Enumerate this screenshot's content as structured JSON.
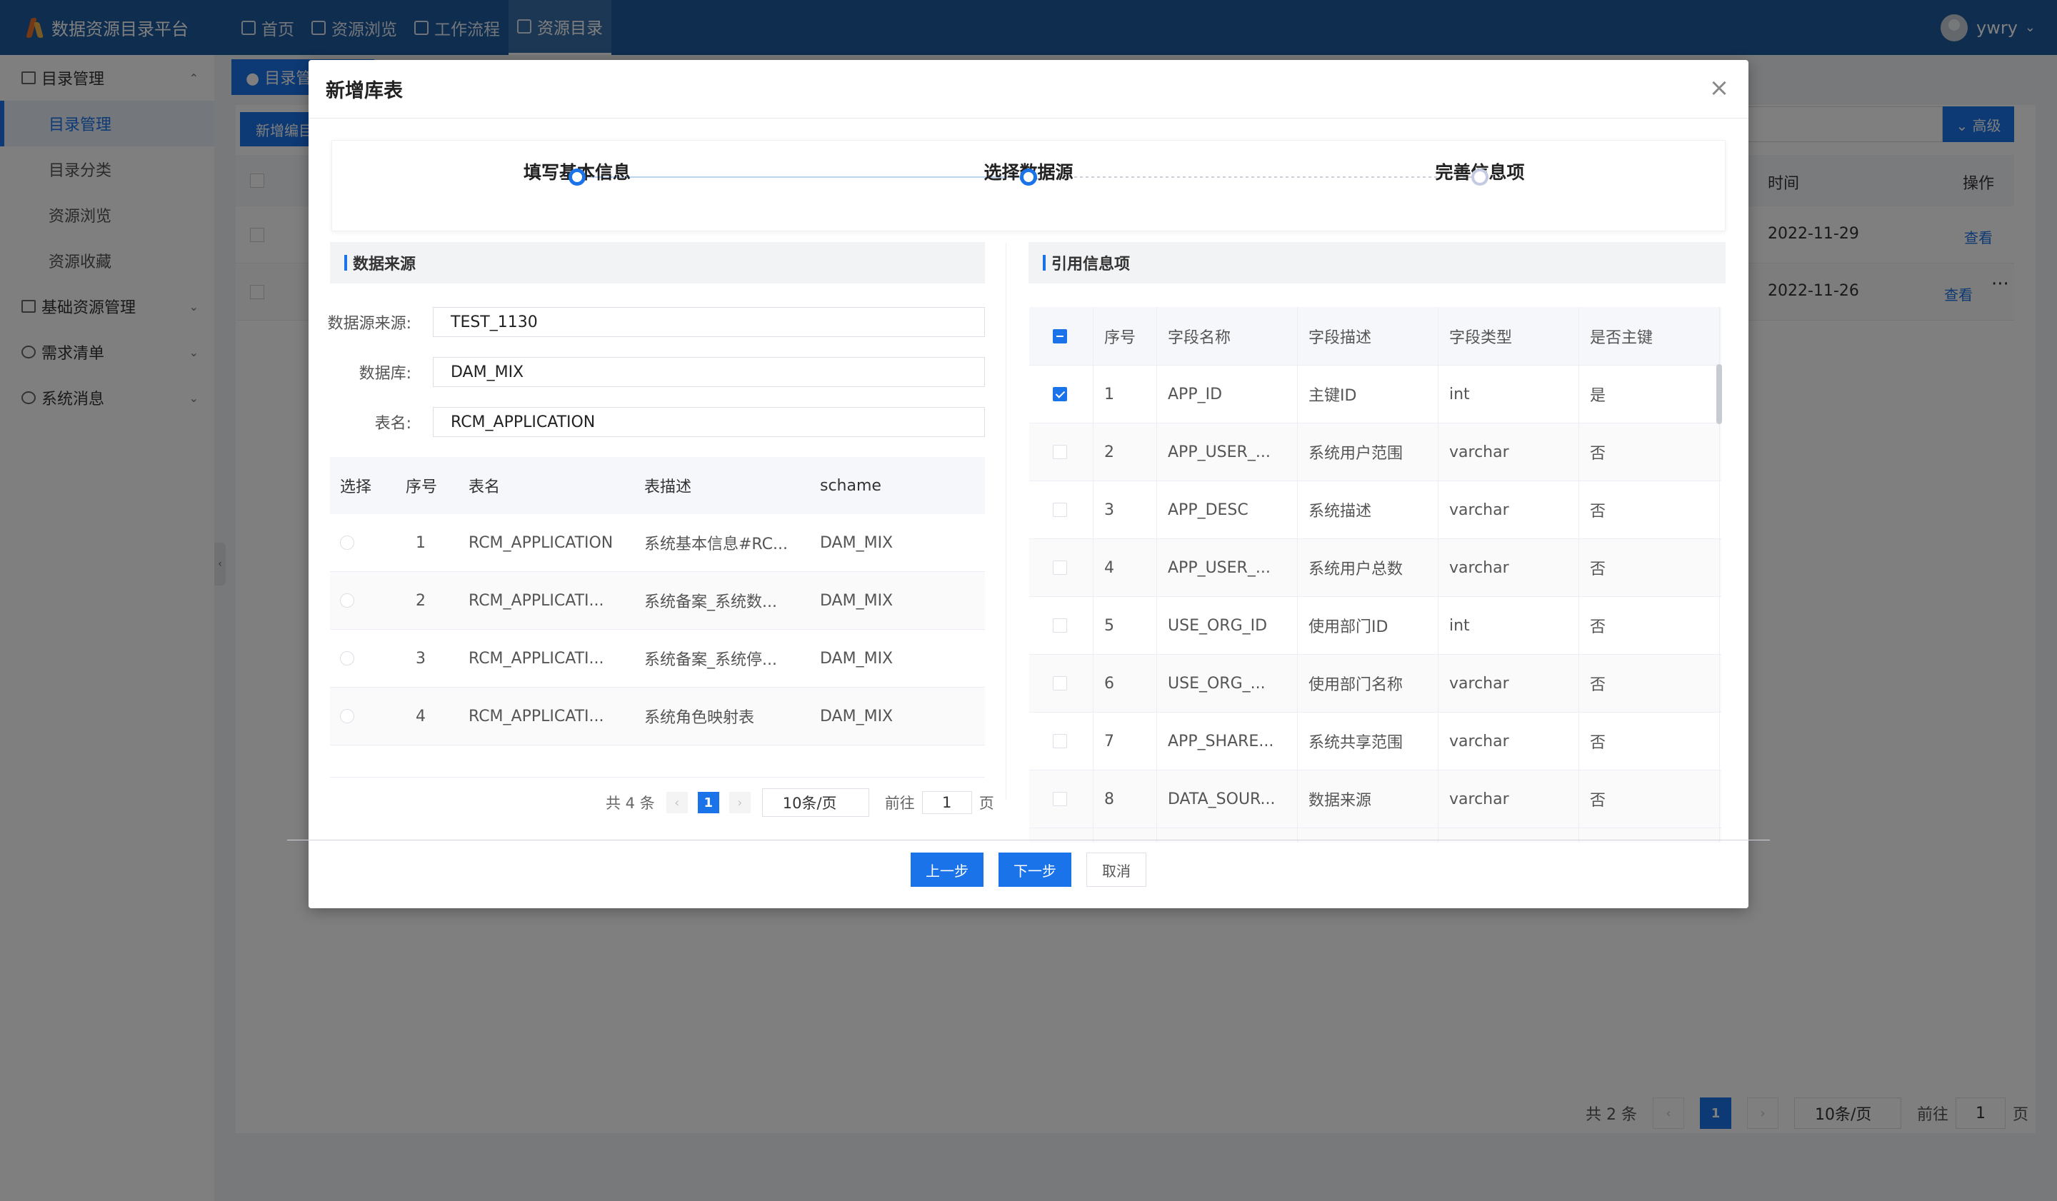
{
  "app": {
    "title": "数据资源目录平台"
  },
  "nav": {
    "items": [
      {
        "label": "首页",
        "icon": "home-icon"
      },
      {
        "label": "资源浏览",
        "icon": "book-icon"
      },
      {
        "label": "工作流程",
        "icon": "workflow-icon"
      },
      {
        "label": "资源目录",
        "icon": "folder-icon",
        "active": true
      }
    ]
  },
  "user": {
    "name": "ywry"
  },
  "sidebar": {
    "groups": [
      {
        "label": "目录管理",
        "icon": "folder-icon",
        "expanded": true,
        "items": [
          {
            "label": "目录管理",
            "active": true
          },
          {
            "label": "目录分类"
          },
          {
            "label": "资源浏览"
          },
          {
            "label": "资源收藏"
          }
        ]
      },
      {
        "label": "基础资源管理",
        "icon": "layers-icon"
      },
      {
        "label": "需求清单",
        "icon": "globe-icon"
      },
      {
        "label": "系统消息",
        "icon": "message-icon"
      }
    ]
  },
  "background": {
    "tag": "● 目录管理",
    "new_button": "新增编目",
    "advanced_button": "⌄ 高级",
    "columns": {
      "time": "时间",
      "actions": "操作"
    },
    "rows": [
      {
        "time": "2022-11-29",
        "action": "查看"
      },
      {
        "time": "2022-11-26",
        "action": "查看",
        "more": "···"
      }
    ],
    "pager": {
      "total": "共 2 条",
      "current": "1",
      "size": "10条/页",
      "goto": "前往",
      "goto_value": "1",
      "page": "页"
    }
  },
  "modal": {
    "title": "新增库表",
    "steps": [
      {
        "label": "填写基本信息",
        "state": "done"
      },
      {
        "label": "选择数据源",
        "state": "active"
      },
      {
        "label": "完善信息项",
        "state": "todo"
      }
    ],
    "left": {
      "section": "数据来源",
      "form": {
        "source_label": "数据源来源:",
        "source_value": "TEST_1130",
        "db_label": "数据库:",
        "db_value": "DAM_MIX",
        "table_label": "表名:",
        "table_value": "RCM_APPLICATION"
      },
      "columns": [
        "选择",
        "序号",
        "表名",
        "表描述",
        "schame"
      ],
      "rows": [
        {
          "no": "1",
          "name": "RCM_APPLICATION",
          "desc": "系统基本信息#RC...",
          "schema": "DAM_MIX"
        },
        {
          "no": "2",
          "name": "RCM_APPLICATI...",
          "desc": "系统备案_系统数...",
          "schema": "DAM_MIX"
        },
        {
          "no": "3",
          "name": "RCM_APPLICATI...",
          "desc": "系统备案_系统停...",
          "schema": "DAM_MIX"
        },
        {
          "no": "4",
          "name": "RCM_APPLICATI...",
          "desc": "系统角色映射表",
          "schema": "DAM_MIX"
        }
      ],
      "pager": {
        "total": "共 4 条",
        "current": "1",
        "size": "10条/页",
        "goto": "前往",
        "goto_value": "1",
        "page": "页"
      }
    },
    "right": {
      "section": "引用信息项",
      "columns": [
        "序号",
        "字段名称",
        "字段描述",
        "字段类型",
        "是否主键"
      ],
      "rows": [
        {
          "checked": true,
          "no": "1",
          "name": "APP_ID",
          "desc": "主键ID",
          "type": "int",
          "pk": "是"
        },
        {
          "checked": false,
          "no": "2",
          "name": "APP_USER_...",
          "desc": "系统用户范围",
          "type": "varchar",
          "pk": "否"
        },
        {
          "checked": false,
          "no": "3",
          "name": "APP_DESC",
          "desc": "系统描述",
          "type": "varchar",
          "pk": "否"
        },
        {
          "checked": false,
          "no": "4",
          "name": "APP_USER_...",
          "desc": "系统用户总数",
          "type": "varchar",
          "pk": "否"
        },
        {
          "checked": false,
          "no": "5",
          "name": "USE_ORG_ID",
          "desc": "使用部门ID",
          "type": "int",
          "pk": "否"
        },
        {
          "checked": false,
          "no": "6",
          "name": "USE_ORG_...",
          "desc": "使用部门名称",
          "type": "varchar",
          "pk": "否"
        },
        {
          "checked": false,
          "no": "7",
          "name": "APP_SHARE...",
          "desc": "系统共享范围",
          "type": "varchar",
          "pk": "否"
        },
        {
          "checked": false,
          "no": "8",
          "name": "DATA_SOUR...",
          "desc": "数据来源",
          "type": "varchar",
          "pk": "否"
        }
      ]
    },
    "buttons": {
      "prev": "上一步",
      "next": "下一步",
      "cancel": "取消"
    }
  },
  "colors": {
    "primary": "#1a73e8",
    "topbar": "#1e5a9e"
  }
}
